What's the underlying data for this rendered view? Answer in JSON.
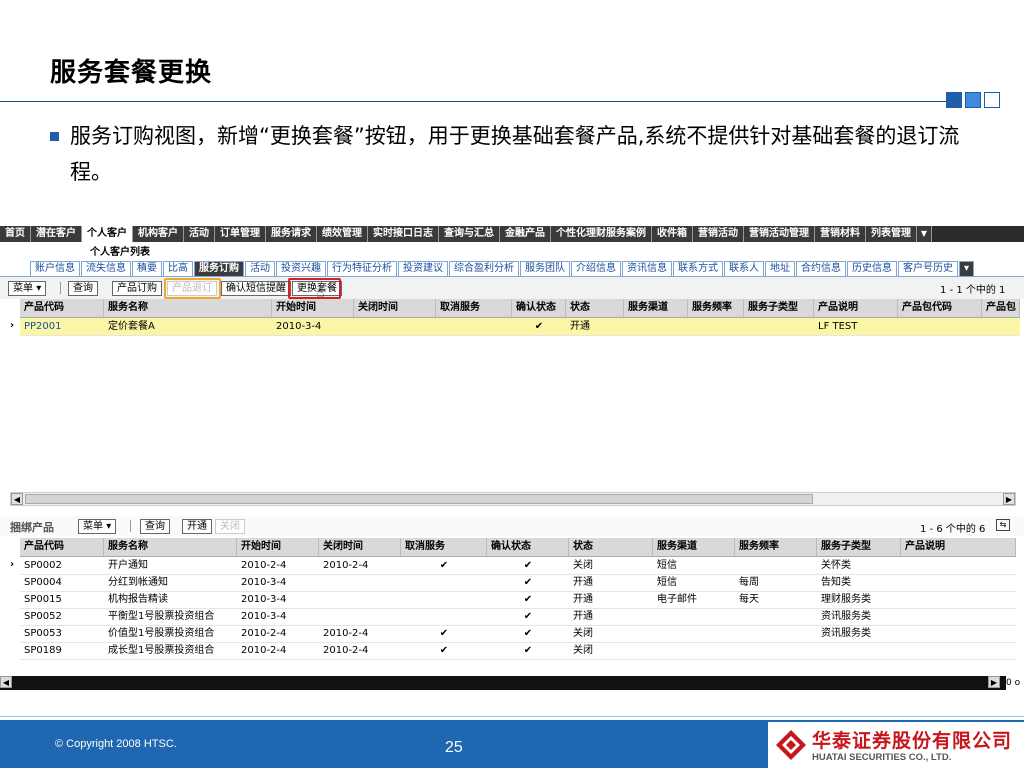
{
  "slide": {
    "title": "服务套餐更换",
    "bullet": "服务订购视图，新增“更换套餐”按钮，用于更换基础套餐产品,系统不提供针对基础套餐的退订流程。",
    "copyright": "© Copyright 2008 HTSC.",
    "page_number": "25",
    "logo_cn": "华泰证券股份有限公司",
    "logo_en": "HUATAI SECURITIES CO., LTD."
  },
  "colors": {
    "accent": "#1f67b0",
    "selected_row": "#fbf6a6",
    "highlight_orange": "#f0a830",
    "highlight_red": "#d62020",
    "logo_red": "#c8161d"
  },
  "main_tabs": [
    "首页",
    "潜在客户",
    "个人客户",
    "机构客户",
    "活动",
    "订单管理",
    "服务请求",
    "绩效管理",
    "实时接口日志",
    "查询与汇总",
    "金融产品",
    "个性化理财服务案例",
    "收件箱",
    "营销活动",
    "营销活动管理",
    "营销材料",
    "列表管理"
  ],
  "main_tabs_active": 2,
  "sub_title": "个人客户列表",
  "sub_tabs": [
    "账户信息",
    "流失信息",
    "積要",
    "比高",
    "服务订购",
    "活动",
    "投资兴趣",
    "行为特征分析",
    "投资建议",
    "综合盈利分析",
    "服务团队",
    "介绍信息",
    "资讯信息",
    "联系方式",
    "联系人",
    "地址",
    "合约信息",
    "历史信息",
    "客户号历史"
  ],
  "sub_tabs_active": 4,
  "toolbar": {
    "menu": "菜单",
    "query": "查询",
    "order": "产品订购",
    "unsubscribe": "产品退订",
    "confirm_sms": "确认短信提醒",
    "change_package": "更换套餐",
    "count": "1 - 1 个中的 1"
  },
  "top_grid": {
    "columns": [
      "产品代码",
      "服务名称",
      "开始时间",
      "关闭时间",
      "取消服务",
      "确认状态",
      "状态",
      "服务渠道",
      "服务频率",
      "服务子类型",
      "产品说明",
      "产品包代码",
      "产品包"
    ],
    "rows": [
      {
        "code": "PP2001",
        "name": "定价套餐A",
        "start": "2010-3-4",
        "end": "",
        "cancel": "",
        "confirm": "✔",
        "status": "开通",
        "channel": "",
        "freq": "",
        "subtype": "",
        "desc": "LF TEST",
        "pkg": "",
        "pkg2": ""
      }
    ]
  },
  "bind": {
    "title": "捆绑产品",
    "menu": "菜单",
    "query": "查询",
    "open": "开通",
    "close": "关闭",
    "count": "1 - 6 个中的 6",
    "columns": [
      "产品代码",
      "服务名称",
      "开始时间",
      "关闭时间",
      "取消服务",
      "确认状态",
      "状态",
      "服务渠道",
      "服务频率",
      "服务子类型",
      "产品说明"
    ],
    "rows": [
      {
        "code": "SP0002",
        "name": "开户通知",
        "start": "2010-2-4",
        "end": "2010-2-4",
        "cancel": "✔",
        "confirm": "✔",
        "status": "关闭",
        "channel": "短信",
        "freq": "",
        "subtype": "关怀类",
        "desc": ""
      },
      {
        "code": "SP0004",
        "name": "分红到帐通知",
        "start": "2010-3-4",
        "end": "",
        "cancel": "",
        "confirm": "✔",
        "status": "开通",
        "channel": "短信",
        "freq": "每周",
        "subtype": "告知类",
        "desc": ""
      },
      {
        "code": "SP0015",
        "name": "机构报告精读",
        "start": "2010-3-4",
        "end": "",
        "cancel": "",
        "confirm": "✔",
        "status": "开通",
        "channel": "电子邮件",
        "freq": "每天",
        "subtype": "理财服务类",
        "desc": ""
      },
      {
        "code": "SP0052",
        "name": "平衡型1号股票投资组合",
        "start": "2010-3-4",
        "end": "",
        "cancel": "",
        "confirm": "✔",
        "status": "开通",
        "channel": "",
        "freq": "",
        "subtype": "资讯服务类",
        "desc": ""
      },
      {
        "code": "SP0053",
        "name": "价值型1号股票投资组合",
        "start": "2010-2-4",
        "end": "2010-2-4",
        "cancel": "✔",
        "confirm": "✔",
        "status": "关闭",
        "channel": "",
        "freq": "",
        "subtype": "资讯服务类",
        "desc": ""
      },
      {
        "code": "SP0189",
        "name": "成长型1号股票投资组合",
        "start": "2010-2-4",
        "end": "2010-2-4",
        "cancel": "✔",
        "confirm": "✔",
        "status": "关闭",
        "channel": "",
        "freq": "",
        "subtype": "",
        "desc": ""
      }
    ]
  },
  "bottom_scroll_text": "0 o"
}
